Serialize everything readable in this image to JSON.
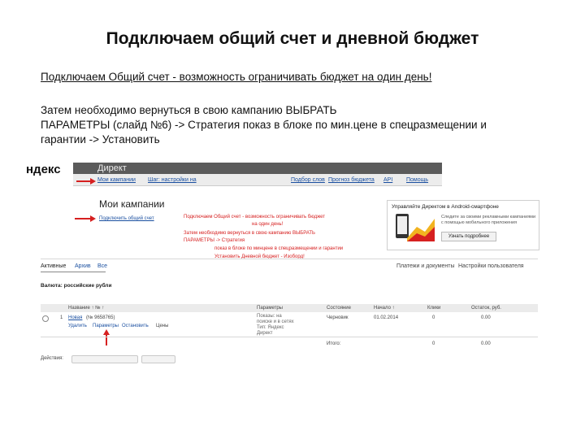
{
  "slide": {
    "title": "Подключаем общий счет и дневной бюджет",
    "line1": "Подключаем Общий счет - возможность ограничивать бюджет на один день!",
    "para_line1": "Затем необходимо вернуться в свою кампанию ВЫБРАТЬ",
    "para_line2": "ПАРАМЕТРЫ (слайд №6) -> Стратегия показ в блоке по мин.цене в спецразмещении и",
    "para_line3": "гарантии -> Установить"
  },
  "screenshot": {
    "logo": "ндекс",
    "product": "Директ",
    "nav": {
      "left": [
        "Мои кампании",
        "Шаг: настройки на"
      ],
      "right": [
        "Подбор слов",
        "Прогноз бюджета",
        "API",
        "Помощь"
      ]
    },
    "heading": "Мои кампании",
    "connect_link": "Подключить общий счет",
    "annotations": [
      "Подключаем Общий счет - возможность ограничивать бюджет",
      "на один день!",
      "Затем необходимо вернуться в свою кампанию ВЫБРАТЬ",
      "ПАРАМЕТРЫ -> Стратегия",
      "показ в блоке по минцене в спецразмещении и гарантии",
      "Установить Дневной бюджет - Изоборд!"
    ],
    "promo": {
      "title": "Управляйте Директом в Android-смартфоне",
      "text": [
        "Следите за своими рекламными кампаниями",
        "с помощью мобильного приложения"
      ],
      "button": "Узнать подробнее"
    },
    "filters": [
      "Активные",
      "Архив",
      "Все"
    ],
    "right_links": [
      "Платежи и документы",
      "Настройки пользователя"
    ],
    "currency": "Валюта: российские рубли",
    "table": {
      "headers": [
        "Название ↑ № ↑",
        "Параметры",
        "Состояние",
        "Начало ↑",
        "Клики",
        "Остаток, руб."
      ],
      "row": {
        "num": "1",
        "name": "Новая",
        "id": "(№ 9658765)",
        "params": [
          "Показы: на",
          "поиске и в сетях",
          "Тип: Яндекс",
          "Директ"
        ],
        "status": "Черновик",
        "start": "01.02.2014",
        "clicks": "0",
        "balance": "0.00",
        "actions": [
          "Удалить",
          "Параметры",
          "Остановить",
          "Цены"
        ]
      },
      "total_label": "Итого:",
      "total_clicks": "0",
      "total_balance": "0.00"
    },
    "bottom": [
      "Действия:"
    ]
  },
  "colors": {
    "annotation_red": "#d62020",
    "link_blue": "#1a4fa0",
    "header_dark": "#5b5b5b"
  }
}
